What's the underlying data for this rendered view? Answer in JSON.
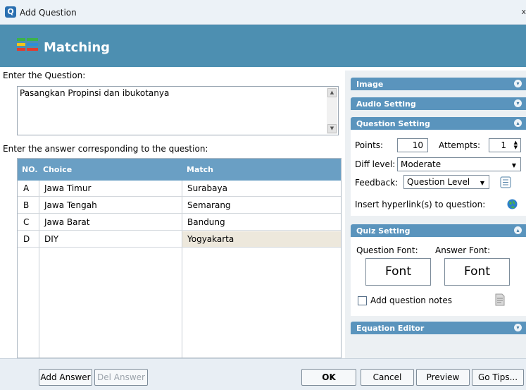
{
  "window": {
    "title": "Add Question",
    "close_glyph": "x"
  },
  "header": {
    "question_type": "Matching",
    "icon": "matching-icon"
  },
  "question": {
    "label": "Enter the Question:",
    "text": "Pasangkan Propinsi dan ibukotanya"
  },
  "answers": {
    "label": "Enter the answer corresponding to the question:",
    "columns": [
      "NO.",
      "Choice",
      "Match"
    ],
    "rows": [
      {
        "no": "A",
        "choice": "Jawa Timur",
        "match": "Surabaya"
      },
      {
        "no": "B",
        "choice": "Jawa Tengah",
        "match": "Semarang"
      },
      {
        "no": "C",
        "choice": "Jawa Barat",
        "match": "Bandung"
      },
      {
        "no": "D",
        "choice": "DIY",
        "match": "Yogyakarta"
      }
    ]
  },
  "sections": {
    "image": "Image",
    "audio": "Audio Setting",
    "question_setting": "Question Setting",
    "quiz_setting": "Quiz Setting",
    "equation_editor": "Equation Editor"
  },
  "question_setting": {
    "points_label": "Points:",
    "points_value": "10",
    "attempts_label": "Attempts:",
    "attempts_value": "1",
    "diff_label": "Diff level:",
    "diff_value": "Moderate",
    "feedback_label": "Feedback:",
    "feedback_value": "Question Level",
    "hyperlink_label": "Insert hyperlink(s) to question:"
  },
  "quiz_setting": {
    "question_font_label": "Question Font:",
    "answer_font_label": "Answer Font:",
    "font_button": "Font",
    "notes_label": "Add question notes"
  },
  "buttons": {
    "add_answer": "Add Answer",
    "del_answer": "Del Answer",
    "ok": "OK",
    "cancel": "Cancel",
    "preview": "Preview",
    "go_tips": "Go Tips..."
  },
  "colors": {
    "banner": "#4d8fb1",
    "section_header": "#5a94bd",
    "grid_header": "#6a9fc4"
  }
}
